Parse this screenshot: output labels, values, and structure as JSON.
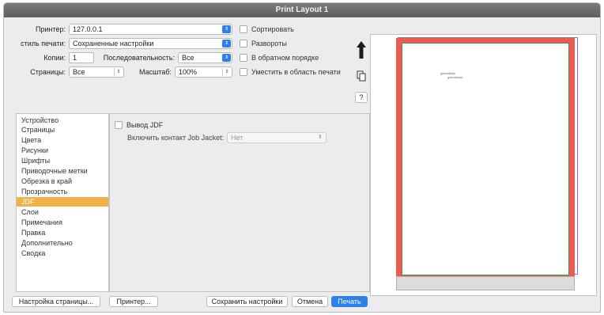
{
  "window": {
    "title": "Print Layout 1"
  },
  "printer": {
    "label": "Принтер:",
    "value": "127.0.0.1"
  },
  "print_style": {
    "label": "стиль печати:",
    "value": "Сохраненные настройки"
  },
  "copies": {
    "label": "Копии:",
    "value": "1"
  },
  "sequence": {
    "label": "Последовательность:",
    "value": "Все"
  },
  "pages": {
    "label": "Страницы:",
    "value": "Все"
  },
  "scale": {
    "label": "Масштаб:",
    "value": "100%"
  },
  "options": {
    "collate": "Сортировать",
    "spreads": "Развороты",
    "reverse": "В обратном порядке",
    "fit": "Уместить в область печати"
  },
  "help_label": "?",
  "categories": [
    "Устройство",
    "Страницы",
    "Цвета",
    "Рисунки",
    "Шрифты",
    "Приводочные метки",
    "Обрезка в край",
    "Прозрачность",
    "JDF",
    "Слои",
    "Примечания",
    "Правка",
    "Дополнительно",
    "Сводка"
  ],
  "selected_category": "JDF",
  "jdf": {
    "output_label": "Вывод JDF",
    "contact_label": "Включить контакт Job Jacket:",
    "contact_value": "Нет"
  },
  "preview": {
    "text_line1": "gdsmdsnjn",
    "text_line2": "gdsmdsnjn"
  },
  "buttons": {
    "page_setup": "Настройка страницы...",
    "printer": "Принтер...",
    "save_settings": "Сохранить настройки",
    "cancel": "Отмена",
    "print": "Печать"
  },
  "colors": {
    "accent": "#2f7fe8",
    "selection": "#f0b244",
    "bleed": "#ee5a4f"
  }
}
